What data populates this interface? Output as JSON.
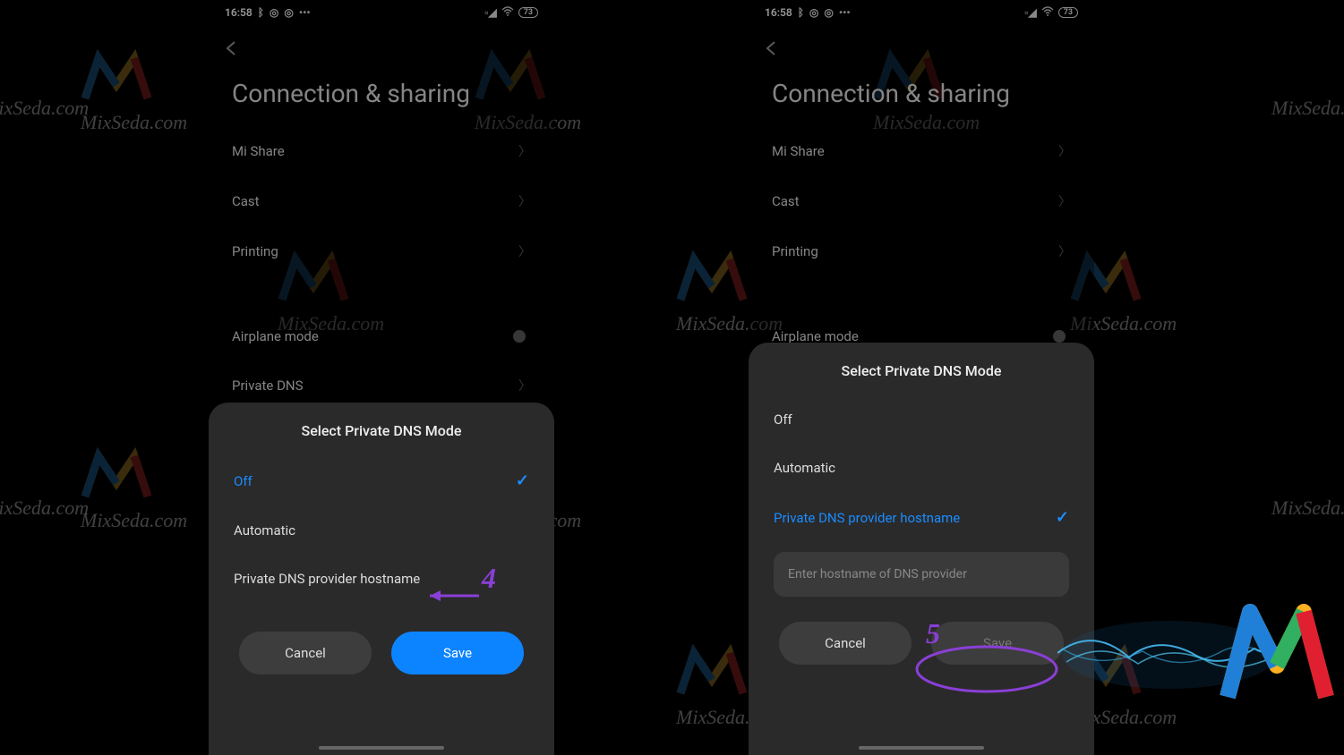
{
  "watermark_text": "MixSeda.com",
  "statusbar": {
    "time": "16:58",
    "battery": "73"
  },
  "page": {
    "title": "Connection & sharing",
    "items": [
      "Mi Share",
      "Cast",
      "Printing",
      "Airplane mode",
      "Private DNS"
    ]
  },
  "dialog": {
    "title": "Select Private DNS Mode",
    "options": [
      "Off",
      "Automatic",
      "Private DNS provider hostname"
    ],
    "input_placeholder": "Enter hostname of DNS provider",
    "cancel": "Cancel",
    "save": "Save"
  },
  "annotations": {
    "step4": "4",
    "step5": "5"
  }
}
